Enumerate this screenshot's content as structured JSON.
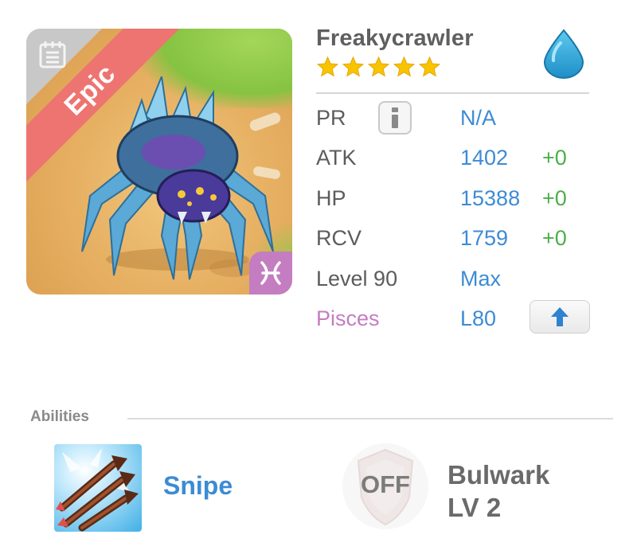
{
  "monster": {
    "name": "Freakycrawler",
    "rarity": "Epic",
    "stars": 5,
    "element_icon": "water-drop-icon",
    "zodiac_icon": "pisces-icon",
    "colors": {
      "rarity_ribbon": "#ee7471",
      "zodiac": "#c47dc1",
      "stat_value": "#3d8bd4",
      "bonus": "#4caf48",
      "star": "#f8c400"
    }
  },
  "stats": [
    {
      "label": "PR",
      "value": "N/A",
      "bonus": ""
    },
    {
      "label": "ATK",
      "value": "1402",
      "bonus": "+0"
    },
    {
      "label": "HP",
      "value": "15388",
      "bonus": "+0"
    },
    {
      "label": "RCV",
      "value": "1759",
      "bonus": "+0"
    },
    {
      "label": "Level 90",
      "value": "Max",
      "bonus": ""
    },
    {
      "label": "Pisces",
      "value": "L80",
      "bonus": ""
    }
  ],
  "abilities": {
    "title": "Abilities",
    "items": [
      {
        "name": "Snipe",
        "icon": "arrows-icon"
      },
      {
        "name_line1": "Bulwark",
        "name_line2": "LV 2",
        "state": "OFF",
        "icon": "shield-icon"
      }
    ]
  }
}
